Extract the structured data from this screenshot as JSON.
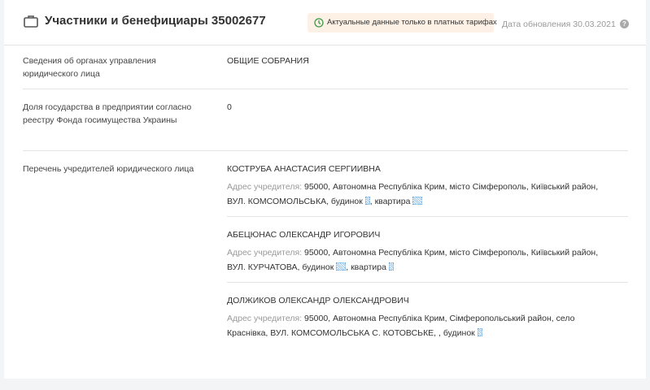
{
  "header": {
    "title": "Участники и бенефициары 35002677",
    "paid_badge": "Актуальные данные только в платных тарифах",
    "update_date": "Дата обновления 30.03.2021",
    "help_symbol": "?"
  },
  "colors": {
    "badge_bg": "#fdf1e6",
    "badge_icon": "#3c9a4a",
    "separator": "#e4e4e4"
  },
  "icons": {
    "header": "briefcase-icon",
    "badge": "clock-icon",
    "help": "question-icon"
  },
  "rows": [
    {
      "label": "Сведения об органах управления юридического лица",
      "value": "ОБЩИЕ СОБРАНИЯ"
    },
    {
      "label": "Доля государства в предприятии согласно реестру Фонда госимущества Украины",
      "value": "0"
    },
    {
      "label": "Перечень учредителей юридического лица"
    }
  ],
  "founders": [
    {
      "name": "КОСТРУБА АНАСТАСИЯ СЕРГИИВНА",
      "addr_label": "Адрес учредителя:",
      "addr_line1": "95000, Автономна Республіка Крим, місто Сімферополь, Київський район,",
      "addr_line2": "ВУЛ. КОМСОМОЛЬСЬКА, будинок",
      "addr_mid": ", квартира"
    },
    {
      "name": "АБЕЦЮНАС ОЛЕКСАНДР ИГОРОВИЧ",
      "addr_label": "Адрес учредителя:",
      "addr_line1": "95000, Автономна Республіка Крим, місто Сімферополь, Київський район,",
      "addr_line2": "ВУЛ. КУРЧАТОВА, будинок",
      "addr_mid": ", квартира"
    },
    {
      "name": "ДОЛЖИКОВ ОЛЕКСАНДР ОЛЕКСАНДРОВИЧ",
      "addr_label": "Адрес учредителя:",
      "addr_line1": "95000, Автономна Республіка Крим, Сімферопольський район, село",
      "addr_line2": "Краснівка, ВУЛ. КОМСОМОЛЬСЬКА С. КОТОВСЬКЕ, , будинок"
    }
  ]
}
